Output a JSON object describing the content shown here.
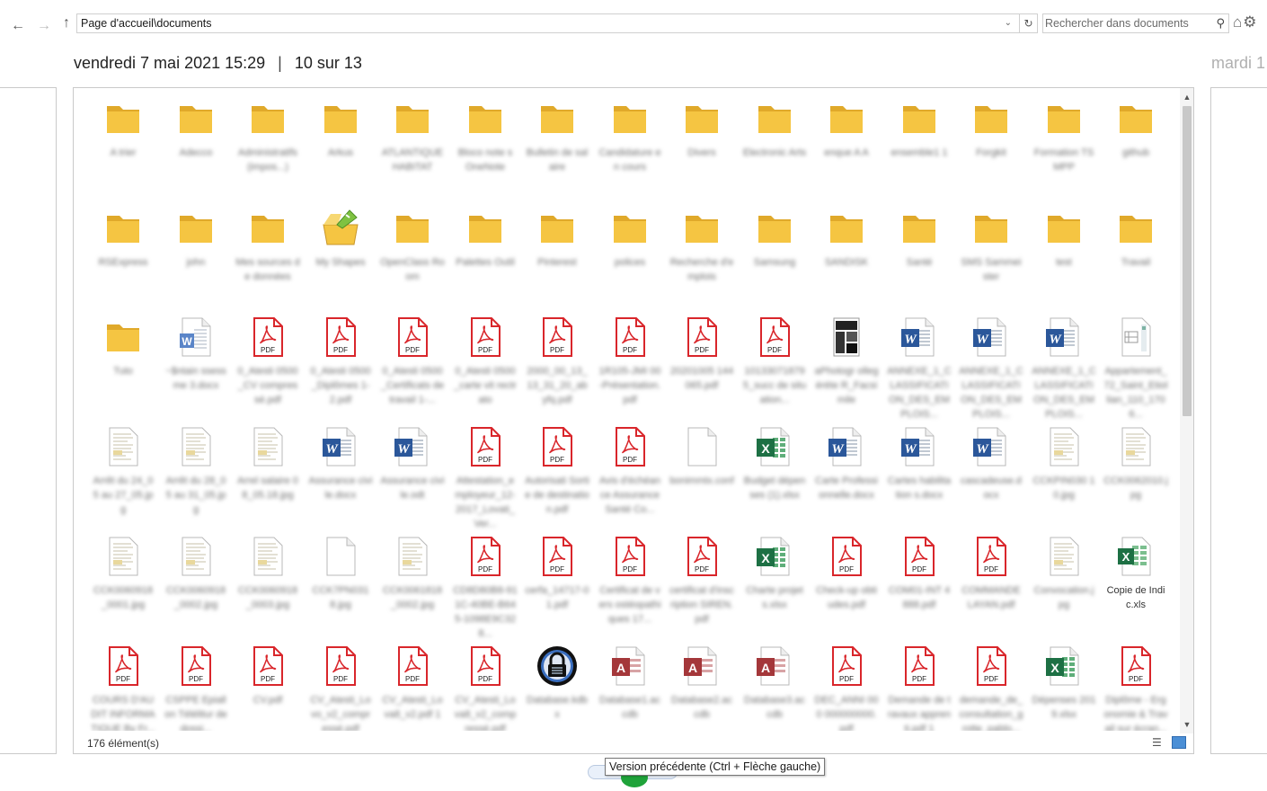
{
  "address": {
    "path": "Page d'accueil\\documents"
  },
  "search": {
    "placeholder": "Rechercher dans documents"
  },
  "header": {
    "date": "vendredi 7 mai 2021 15:29",
    "separator": "|",
    "position": "10 sur 13"
  },
  "next_version_date": "mardi 1",
  "status": {
    "item_count": "176 élément(s)"
  },
  "tooltip": "Version précédente (Ctrl + Flèche gauche)",
  "colors": {
    "folder": "#f5c542",
    "pdf": "#d9262b",
    "word": "#2b579a",
    "excel": "#1d7044",
    "access": "#a4373a"
  },
  "icons": {
    "back": "arrow-left-icon",
    "forward": "arrow-right-icon",
    "up": "arrow-up-icon",
    "refresh": "refresh-icon",
    "search": "search-icon",
    "home": "home-icon",
    "settings": "gear-icon"
  },
  "rows": [
    [
      {
        "type": "folder",
        "label": "A trier"
      },
      {
        "type": "folder",
        "label": "Adecco"
      },
      {
        "type": "folder",
        "label": "Administratifs (impos...)"
      },
      {
        "type": "folder",
        "label": "Arkus"
      },
      {
        "type": "folder",
        "label": "ATLANTIQUE HABITAT"
      },
      {
        "type": "folder",
        "label": "Bloco note s OneNote"
      },
      {
        "type": "folder",
        "label": "Bulletin de salaire"
      },
      {
        "type": "folder",
        "label": "Candidature en cours"
      },
      {
        "type": "folder",
        "label": "Divers"
      },
      {
        "type": "folder",
        "label": "Electronic Arts"
      },
      {
        "type": "folder",
        "label": "enque A A"
      },
      {
        "type": "folder",
        "label": "ensemble1 1"
      },
      {
        "type": "folder",
        "label": "Forgkit"
      },
      {
        "type": "folder",
        "label": "Formation TSMPP"
      },
      {
        "type": "folder",
        "label": "github"
      }
    ],
    [
      {
        "type": "folder",
        "label": "RSExpress"
      },
      {
        "type": "folder",
        "label": "john"
      },
      {
        "type": "folder",
        "label": "Mes sources de données"
      },
      {
        "type": "shapes",
        "label": "My Shapes"
      },
      {
        "type": "folder",
        "label": "OpenClass Room"
      },
      {
        "type": "folder",
        "label": "Palettes Outil"
      },
      {
        "type": "folder",
        "label": "Pinterest"
      },
      {
        "type": "folder",
        "label": "polices"
      },
      {
        "type": "folder",
        "label": "Recherche d'emplois"
      },
      {
        "type": "folder",
        "label": "Samsung"
      },
      {
        "type": "folder",
        "label": "SANDISK"
      },
      {
        "type": "folder",
        "label": "Santé"
      },
      {
        "type": "folder",
        "label": "SMS Sammeister"
      },
      {
        "type": "folder",
        "label": "test"
      },
      {
        "type": "folder",
        "label": "Travail"
      }
    ],
    [
      {
        "type": "folder",
        "label": "Tuto"
      },
      {
        "type": "wordfile",
        "label": "~$ntain ssessme 3.docx"
      },
      {
        "type": "pdf",
        "label": "0_Atesti 0500_CV compressé.pdf"
      },
      {
        "type": "pdf",
        "label": "0_Atesti 0500_Diplômes 1-2.pdf"
      },
      {
        "type": "pdf",
        "label": "0_Atesti 0500_Certificats de travail 1-..."
      },
      {
        "type": "pdf",
        "label": "0_Atesti 0500_carte vit rectrato"
      },
      {
        "type": "pdf",
        "label": "2000_00_13_13_31_20_abyfq.pdf"
      },
      {
        "type": "pdf",
        "label": "1R105-JMI 00-Présentation.pdf"
      },
      {
        "type": "pdf",
        "label": "20201005 144065.pdf"
      },
      {
        "type": "pdf",
        "label": "101330718795_succ de situation..."
      },
      {
        "type": "image",
        "label": "aPhotogr ollegéréte R_Facsimile"
      },
      {
        "type": "word",
        "label": "ANNEXE_1_CLASSIFICATION_DES_EMPLOIS..."
      },
      {
        "type": "word",
        "label": "ANNEXE_1_CLASSIFICATION_DES_EMPLOIS..."
      },
      {
        "type": "word",
        "label": "ANNEXE_1_CLASSIFICATION_DES_EMPLOIS..."
      },
      {
        "type": "plan",
        "label": "Appartement_72_Saint_Etiollian_110_1706..."
      }
    ],
    [
      {
        "type": "scan",
        "label": "Arrêt du 24_05 au 27_05.jpg"
      },
      {
        "type": "scan",
        "label": "Arrêt du 28_05 au 31_05.jpg"
      },
      {
        "type": "scan",
        "label": "Arrel salaire 08_05.18.jpg"
      },
      {
        "type": "word",
        "label": "Assurance civile.docx"
      },
      {
        "type": "word",
        "label": "Assurance civile.odt"
      },
      {
        "type": "pdf",
        "label": "Attestation_employeur_12-2017_Lovati_Ver..."
      },
      {
        "type": "pdf",
        "label": "Autorisati Sortie de destination.pdf"
      },
      {
        "type": "pdf",
        "label": "Avis d'échéance Assurance Santé Co..."
      },
      {
        "type": "blank",
        "label": "bonimmtx.conf"
      },
      {
        "type": "excel",
        "label": "Budget dépenses (1).xlsx"
      },
      {
        "type": "word",
        "label": "Carte Professionnelle.docx"
      },
      {
        "type": "word",
        "label": "Cartes habilitation s.docx"
      },
      {
        "type": "word",
        "label": "cascadeuse.docx"
      },
      {
        "type": "scan",
        "label": "CCKPIN030 10.jpg"
      },
      {
        "type": "scan",
        "label": "CCK0062010.jpg"
      }
    ],
    [
      {
        "type": "scan",
        "label": "CCK0060918_0001.jpg"
      },
      {
        "type": "scan",
        "label": "CCK0060918_0002.jpg"
      },
      {
        "type": "scan",
        "label": "CCK0060918_0003.jpg"
      },
      {
        "type": "blank",
        "label": "CCK7PN0318.jpg"
      },
      {
        "type": "scan",
        "label": "CCK0061818_0002.jpg"
      },
      {
        "type": "pdf",
        "label": "CD8D80B8-911C-40BE-B645-1098E9C328..."
      },
      {
        "type": "pdf",
        "label": "cerfa_14717-01.pdf"
      },
      {
        "type": "pdf",
        "label": "Certificat de vers ostéopathiques 17..."
      },
      {
        "type": "pdf",
        "label": "certificat d'inscription SIREN.pdf"
      },
      {
        "type": "excel",
        "label": "Charte projets.xlsx"
      },
      {
        "type": "pdf",
        "label": "Check-up obtiudes.pdf"
      },
      {
        "type": "pdf",
        "label": "COM01-INT 4888.pdf"
      },
      {
        "type": "pdf",
        "label": "COMMANDE LAYAN.pdf"
      },
      {
        "type": "scan",
        "label": "Convocation.jpg"
      },
      {
        "type": "excelfile",
        "label": "Copie de Indic.xls",
        "clear": true
      }
    ],
    [
      {
        "type": "pdf",
        "label": "COURS D'AUDIT INFORMATIQUE By Fr..."
      },
      {
        "type": "pdf",
        "label": "CSPPE Epiallon Télélitur de dossi..."
      },
      {
        "type": "pdf",
        "label": "CV.pdf"
      },
      {
        "type": "pdf",
        "label": "CV_Atesti_Lovo_v2_compressé.pdf"
      },
      {
        "type": "pdf",
        "label": "CV_Atesti_Lova8_v2.pdf 1"
      },
      {
        "type": "pdf",
        "label": "CV_Atesti_Lova8_v2_compressé.pdf"
      },
      {
        "type": "keepass",
        "label": "Database.kdbx"
      },
      {
        "type": "access",
        "label": "Database1.accdb"
      },
      {
        "type": "access",
        "label": "Database2.accdb"
      },
      {
        "type": "access",
        "label": "Database3.accdb"
      },
      {
        "type": "pdf",
        "label": "DEC_ANNI 000 000000000.pdf"
      },
      {
        "type": "pdf",
        "label": "Demande de travaux apprenti.pdf 1"
      },
      {
        "type": "pdf",
        "label": "demande_de_consultation_grotte_pablo..."
      },
      {
        "type": "excel",
        "label": "Dépenses 2019.xlsx"
      },
      {
        "type": "pdf",
        "label": "Diplôme - Ergonomie & Travail sur écran..."
      }
    ]
  ]
}
